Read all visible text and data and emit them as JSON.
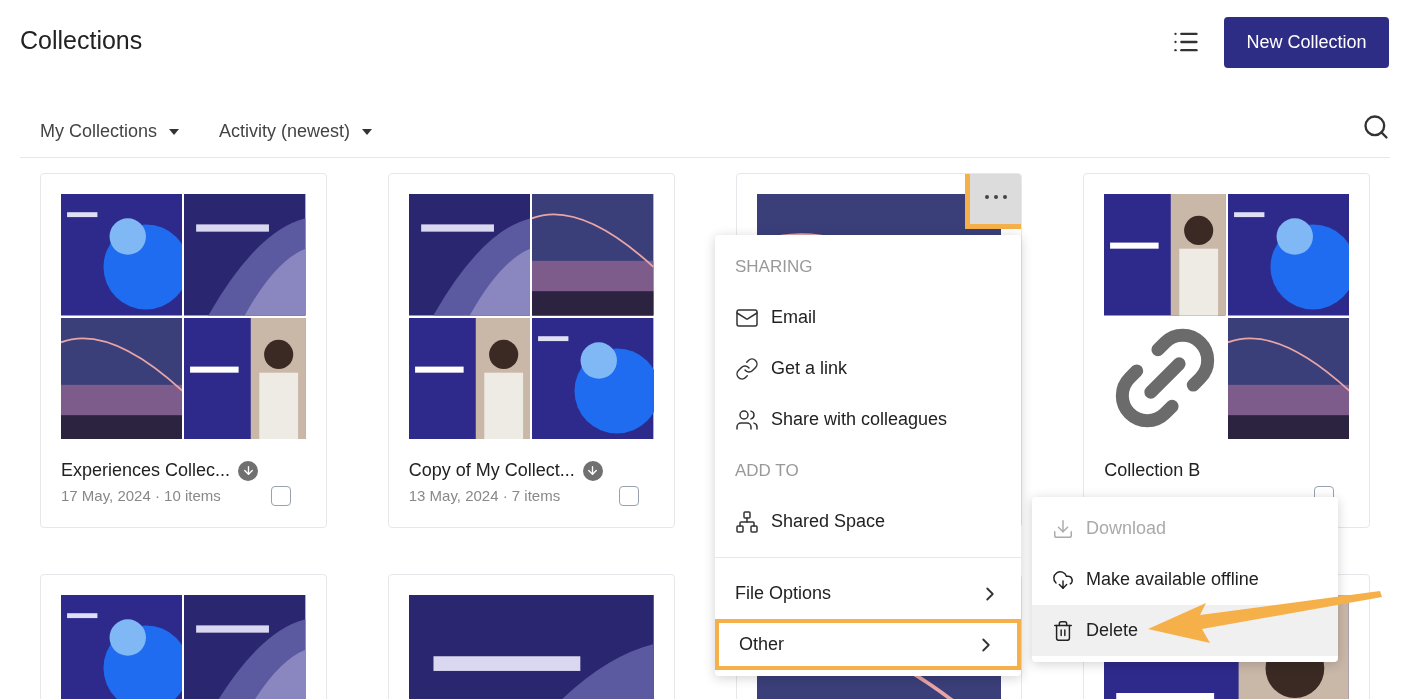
{
  "header": {
    "title": "Collections",
    "new_button": "New Collection"
  },
  "filters": [
    {
      "label": "My Collections"
    },
    {
      "label": "Activity (newest)"
    }
  ],
  "cards": [
    {
      "title": "Experiences Collec...",
      "meta": "17 May, 2024 · 10 items",
      "offline": true,
      "shared": false,
      "checked": false,
      "tiles": [
        {
          "kind": "picture"
        },
        {
          "kind": "picture"
        },
        {
          "kind": "picture"
        },
        {
          "kind": "picture"
        }
      ]
    },
    {
      "title": "Copy of My Collect...",
      "meta": "13 May, 2024 · 7 items",
      "offline": true,
      "shared": false,
      "checked": false,
      "tiles": [
        {
          "kind": "picture"
        },
        {
          "kind": "picture"
        },
        {
          "kind": "picture"
        },
        {
          "kind": "picture"
        }
      ]
    },
    {
      "more_highlighted": true,
      "tiles": [
        {
          "kind": "picture"
        }
      ]
    },
    {
      "title": "Collection B",
      "offline": false,
      "checked": false,
      "tiles": [
        {
          "kind": "picture"
        },
        {
          "kind": "picture"
        },
        {
          "kind": "link"
        },
        {
          "kind": "picture"
        }
      ]
    },
    {
      "tiles": [
        {
          "kind": "picture"
        },
        {
          "kind": "picture"
        }
      ]
    },
    {
      "tiles": [
        {
          "kind": "picture"
        }
      ]
    },
    {
      "tiles": [
        {
          "kind": "picture"
        }
      ]
    },
    {
      "tiles": [
        {
          "kind": "picture"
        }
      ]
    }
  ],
  "menu": {
    "items": [
      {
        "kind": "heading",
        "label": "SHARING"
      },
      {
        "kind": "item",
        "label": "Email"
      },
      {
        "kind": "item",
        "label": "Get a link"
      },
      {
        "kind": "item",
        "label": "Share with colleagues"
      },
      {
        "kind": "heading",
        "label": "ADD TO"
      },
      {
        "kind": "item",
        "label": "Shared Space"
      },
      {
        "kind": "divider"
      },
      {
        "kind": "submenu",
        "label": "File Options",
        "highlighted": false
      },
      {
        "kind": "submenu",
        "label": "Other",
        "highlighted": true
      }
    ]
  },
  "submenu": {
    "items": [
      {
        "label": "Download",
        "disabled": true,
        "selected": false
      },
      {
        "label": "Make available offline",
        "disabled": false,
        "selected": false
      },
      {
        "label": "Delete",
        "disabled": false,
        "selected": true
      }
    ]
  },
  "annotations": [
    {
      "kind": "arrow",
      "color": "#f5b04a"
    }
  ]
}
